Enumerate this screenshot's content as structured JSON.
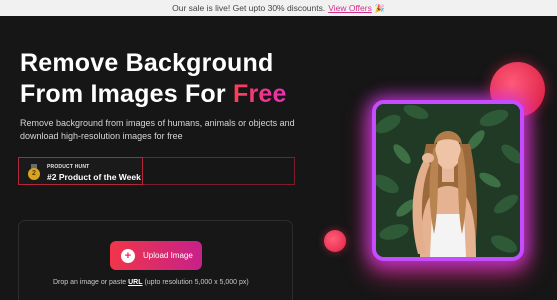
{
  "banner": {
    "text": "Our sale is live! Get upto 30% discounts.",
    "link": "View Offers",
    "emoji": "🎉"
  },
  "hero": {
    "title_line1": "Remove Background",
    "title_line2_prefix": "From Images For",
    "title_highlight": "Free",
    "subtitle": "Remove background from images of humans, animals or objects and download high-resolution images for free"
  },
  "product_hunt": {
    "small_label": "PRODUCT HUNT",
    "main_label": "#2 Product of the Week",
    "medal_text": "2"
  },
  "upload": {
    "button_label": "Upload Image",
    "drop_prefix": "Drop an image or paste",
    "drop_link": "URL",
    "drop_suffix": "(upto resolution 5,000 x 5,000 px)"
  },
  "colors": {
    "accent_red": "#f1354a",
    "accent_magenta": "#c6218a",
    "frame_purple": "#c64cff",
    "background": "#161616"
  },
  "icons": {
    "upload": "plus-circle-icon",
    "medal": "medal-icon",
    "banner": "party-popper-icon"
  }
}
